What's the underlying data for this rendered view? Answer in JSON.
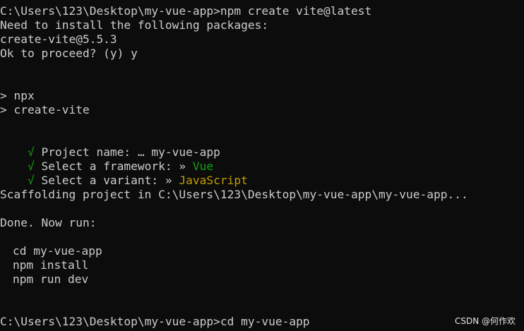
{
  "terminal": {
    "lines": {
      "cmd_create": "C:\\Users\\123\\Desktop\\my-vue-app>npm create vite@latest",
      "need_install": "Need to install the following packages:",
      "package_name": "create-vite@5.5.3",
      "ok_proceed": "Ok to proceed? (y) y",
      "npx_prompt": "> npx",
      "create_vite_prompt": "> create-vite",
      "project_name_check": "√",
      "project_name_label": " Project name: … my-vue-app",
      "framework_check": "√",
      "framework_label": " Select a framework: » ",
      "framework_value": "Vue",
      "variant_check": "√",
      "variant_label": " Select a variant: » ",
      "variant_value": "JavaScript",
      "scaffolding": "Scaffolding project in C:\\Users\\123\\Desktop\\my-vue-app\\my-vue-app...",
      "done": "Done. Now run:",
      "cd_cmd": "cd my-vue-app",
      "npm_install": "npm install",
      "npm_run_dev": "npm run dev",
      "cmd_cd": "C:\\Users\\123\\Desktop\\my-vue-app>cd my-vue-app"
    },
    "colors": {
      "background": "#0c0c0c",
      "text": "#cccccc",
      "green": "#13a10e",
      "yellow": "#c19c00"
    }
  },
  "watermark": "CSDN @何作欢"
}
